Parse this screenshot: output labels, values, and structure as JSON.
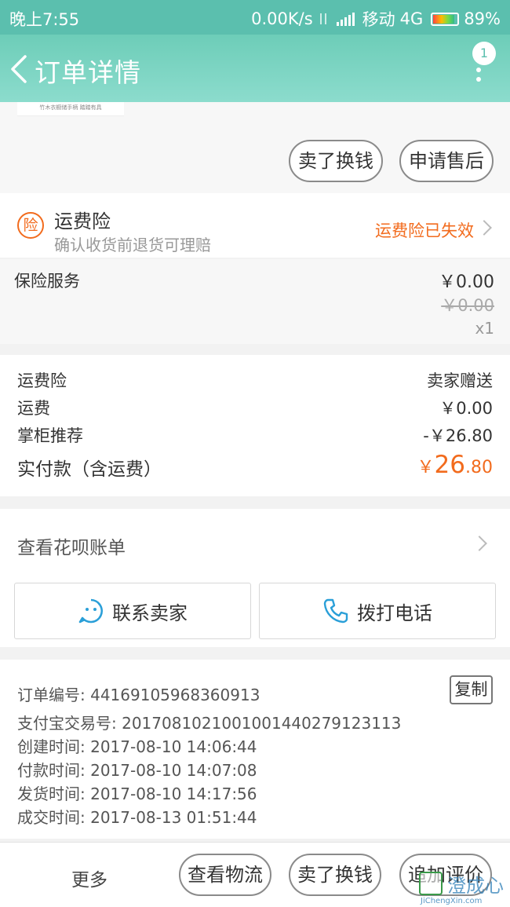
{
  "status_bar": {
    "time": "晚上7:55",
    "speed": "0.00K/s",
    "carrier": "移动",
    "network": "4G",
    "battery": "89%"
  },
  "nav": {
    "title": "订单详情",
    "badge": "1"
  },
  "product_thumb_text": "竹木衣橱储手柄 踏踏有具",
  "item_actions": {
    "exchange": "卖了换钱",
    "after_sale": "申请售后"
  },
  "insurance": {
    "icon_char": "险",
    "title": "运费险",
    "subtitle": "确认收货前退货可理赔",
    "status": "运费险已失效"
  },
  "service": {
    "label": "保险服务",
    "price": "￥0.00",
    "original_price": "￥0.00",
    "qty": "x1"
  },
  "summary": [
    {
      "label": "运费险",
      "value": "卖家赠送"
    },
    {
      "label": "运费",
      "value": "￥0.00"
    },
    {
      "label": "掌柜推荐",
      "value": "-￥26.80"
    }
  ],
  "total": {
    "label": "实付款（含运费）",
    "currency": "￥",
    "integer": "26",
    "decimal": ".80"
  },
  "huabei": {
    "label": "查看花呗账单"
  },
  "contact": {
    "seller": "联系卖家",
    "phone": "拨打电话"
  },
  "order_info": {
    "order_no_label": "订单编号:",
    "order_no": "44169105968360913",
    "copy": "复制",
    "rows": [
      "支付宝交易号: 2017081021001001440279123113",
      "创建时间: 2017-08-10 14:06:44",
      "付款时间: 2017-08-10 14:07:08",
      "发货时间: 2017-08-10 14:17:56",
      "成交时间: 2017-08-13 01:51:44"
    ]
  },
  "bottom_bar": {
    "more": "更多",
    "logistics": "查看物流",
    "exchange": "卖了换钱",
    "review": "追加评价"
  },
  "watermark": {
    "cn": "澄成心",
    "en": "JiChengXin.com"
  },
  "colors": {
    "theme": "#6dcdb8",
    "accent": "#f26b1d",
    "link_blue": "#2a9fd8"
  }
}
